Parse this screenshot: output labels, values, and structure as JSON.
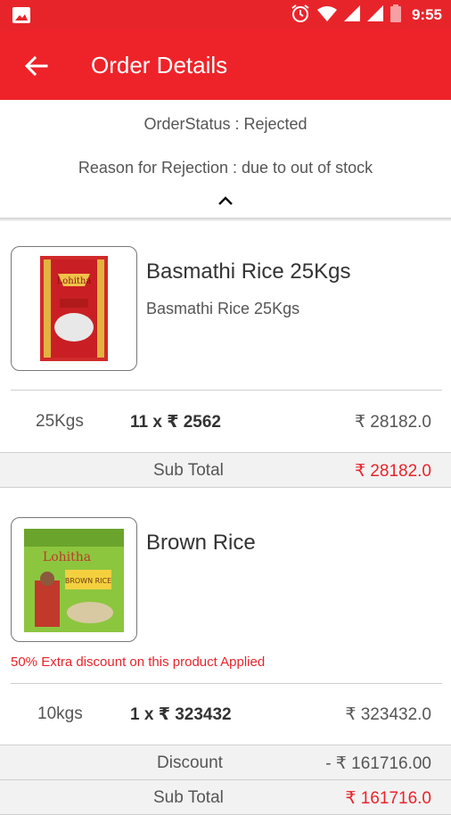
{
  "status_bar": {
    "time": "9:55",
    "icons": [
      "image-icon",
      "alarm-icon",
      "wifi-icon",
      "signal-icon",
      "signal-icon",
      "battery-icon"
    ]
  },
  "app_bar": {
    "title": "Order Details",
    "back_icon": "arrow-left-icon"
  },
  "order": {
    "status": "OrderStatus : Rejected",
    "reason": "Reason for Rejection : due to out of stock"
  },
  "products": [
    {
      "name": "Basmathi Rice 25Kgs",
      "description": "Basmathi Rice 25Kgs",
      "package_label": "Lohitha",
      "weight": "25Kgs",
      "qty_price": "11 x ₹ 2562",
      "amount": "₹ 28182.0",
      "subtotal_label": "Sub Total",
      "subtotal_value": "₹ 28182.0"
    },
    {
      "name": "Brown Rice",
      "description": "",
      "package_label": "Lohitha",
      "package_sub": "BROWN RICE",
      "discount_note": "50% Extra discount on this product Applied",
      "weight": "10kgs",
      "qty_price": "1 x ₹ 323432",
      "amount": "₹ 323432.0",
      "discount_label": "Discount",
      "discount_value": "- ₹ 161716.00",
      "subtotal_label": "Sub Total",
      "subtotal_value": "₹ 161716.0"
    }
  ],
  "colors": {
    "primary": "#ee2329",
    "status_bar": "#e8242b",
    "accent_text": "#e8242b"
  }
}
